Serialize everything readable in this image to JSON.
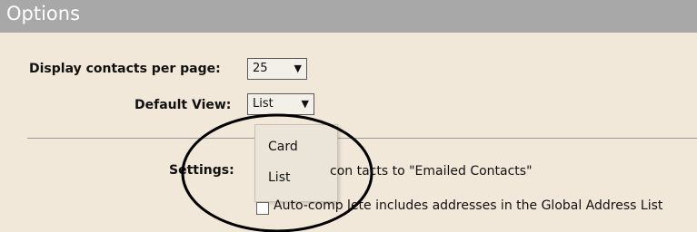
{
  "header": {
    "title": "Options"
  },
  "form": {
    "contacts_per_page_label": "Display contacts per page:",
    "contacts_per_page_value": "25",
    "default_view_label": "Default View:",
    "default_view_value": "List",
    "settings_label": "Settings:"
  },
  "dropdown": {
    "options": [
      "Card",
      "List"
    ]
  },
  "settings": {
    "item1_text_visible": "con tacts to \"Emailed Contacts\"",
    "item2_text_visible": "Auto-comp lete includes addresses in the Global Address List"
  },
  "colors": {
    "titlebar": "#a8a8a8",
    "background": "#f2e8da",
    "annotation": "#000000"
  },
  "icons": {
    "dropdown_arrow": "chevron-down-icon"
  }
}
